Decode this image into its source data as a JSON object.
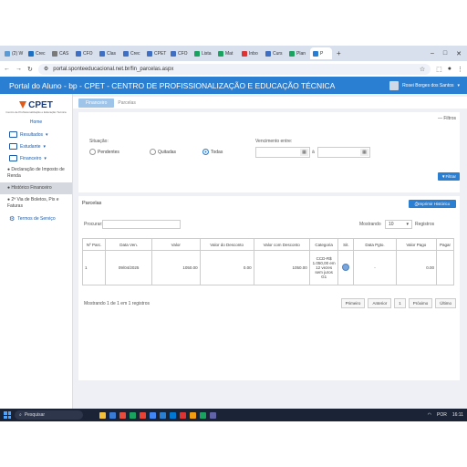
{
  "browser": {
    "tabs": [
      {
        "label": "(2) W",
        "color": "#5b9bd5"
      },
      {
        "label": "Crec",
        "color": "#1d6fc4"
      },
      {
        "label": "CAS",
        "color": "#7a7a7a"
      },
      {
        "label": "CFO",
        "color": "#3f6fc2"
      },
      {
        "label": "Clas",
        "color": "#3f6fc2"
      },
      {
        "label": "Crec",
        "color": "#3f6fc2"
      },
      {
        "label": "CPET",
        "color": "#3f6fc2"
      },
      {
        "label": "CFO",
        "color": "#3f6fc2"
      },
      {
        "label": "Lista",
        "color": "#1aa260"
      },
      {
        "label": "Mat",
        "color": "#1aa260"
      },
      {
        "label": "Inbo",
        "color": "#d33"
      },
      {
        "label": "Curs",
        "color": "#3f6fc2"
      },
      {
        "label": "Plan",
        "color": "#1aa260"
      },
      {
        "label": "P",
        "color": "#2b7fd3"
      }
    ],
    "active_tab_label": "P",
    "new_tab": "+",
    "url": "portal.sponteeducacional.net.br/fin_parcelas.aspx"
  },
  "header": {
    "title": "Portal do Aluno - bp - CPET - CENTRO DE PROFISSIONALIZAÇÃO E EDUCAÇÃO TÉCNICA",
    "user": "Rosei Borges dos Santos"
  },
  "sidebar": {
    "logo": "CPET",
    "logo_sub": "Centro de Profissionalização e Educação Técnica",
    "home": "Home",
    "items": [
      {
        "label": "Resultados"
      },
      {
        "label": "Estudante"
      },
      {
        "label": "Financeiro"
      }
    ],
    "sub_items": [
      {
        "label": "Declaração de Imposto de Renda"
      },
      {
        "label": "Histórico Financeiro"
      },
      {
        "label": "2ª Via de Boletos, Pix e Faturas"
      }
    ],
    "settings": "Termos de Serviço"
  },
  "breadcrumb": {
    "first": "Financeiro",
    "second": "Parcelas"
  },
  "filters": {
    "toggle": "Filtros",
    "situacao_label": "Situação:",
    "options": [
      "Pendentes",
      "Quitadas",
      "Todas"
    ],
    "selected": "Todas",
    "vencimento_label": "Vencimento entre:",
    "separator": "à",
    "button": "Filtrar"
  },
  "parcelas": {
    "title": "Parcelas",
    "print_button": "Imprimir Histórico",
    "search_label": "Procurar:",
    "show_label": "Mostrando",
    "show_value": "10",
    "records_label": "Registros",
    "columns": [
      "Nº Parc.",
      "Data Ven.",
      "Valor",
      "Valor do Desconto",
      "Valor com Desconto",
      "Categoria",
      "Sit.",
      "Data Pgto.",
      "Valor Pago",
      "Pagar"
    ],
    "rows": [
      [
        "1",
        "09/04/2025",
        "1050.00",
        "0.00",
        "1050.00",
        "CCD-R$ 1.050,00 em 12 vezes sem juros G1",
        "",
        "-",
        "0.00",
        ""
      ]
    ],
    "footer": "Mostrando 1 de 1 em 1 registros",
    "pager": [
      "Primeiro",
      "Anterior",
      "1",
      "Próximo",
      "Último"
    ]
  },
  "taskbar": {
    "search": "Pesquisar",
    "lang": "POR",
    "time": "16:11",
    "apps": [
      "#f3c13a",
      "#3a7bd5",
      "#e74c3c",
      "#1aa260",
      "#ea4335",
      "#4285f4",
      "#2b7fd3",
      "#0078d4",
      "#d33",
      "#f39c12",
      "#1aa260",
      "#6264a7"
    ]
  }
}
